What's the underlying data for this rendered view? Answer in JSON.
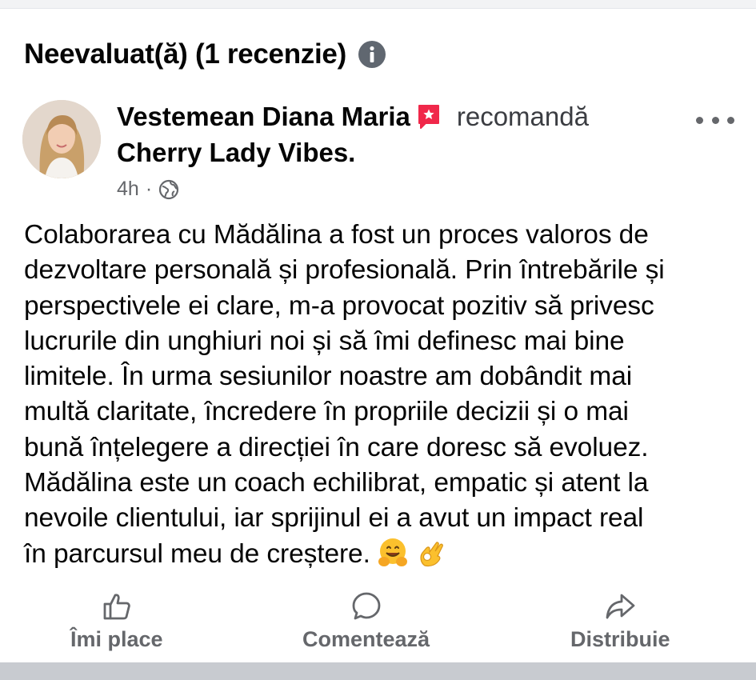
{
  "review_section": {
    "title": "Neevaluat(ă) (1 recenzie)"
  },
  "post": {
    "author": "Vestemean Diana Maria",
    "action": "recomandă",
    "page": "Cherry Lady Vibes.",
    "time": "4h",
    "separator": "·",
    "audience_icon": "globe-icon",
    "recommend_badge_color": "#f0284a",
    "text_lines": [
      "Colaborarea cu Mădălina a fost un proces valoros de",
      "dezvoltare personală și profesională. Prin întrebările și",
      "perspectivele ei clare, m-a provocat pozitiv să privesc",
      "lucrurile din unghiuri noi și să îmi definesc mai bine",
      "limitele. În urma sesiunilor noastre am dobândit mai",
      "multă claritate, încredere în propriile decizii și o mai",
      "bună înțelegere a direcției în care doresc să evoluez.",
      "Mădălina este un coach echilibrat, empatic și atent la",
      "nevoile clientului, iar sprijinul ei a avut un impact real",
      "în parcursul meu de creștere."
    ],
    "emojis": [
      "hugging-face",
      "ok-hand"
    ]
  },
  "actions": {
    "like": "Îmi place",
    "comment": "Comentează",
    "share": "Distribuie"
  },
  "colors": {
    "text": "#050505",
    "secondary": "#65676b"
  }
}
